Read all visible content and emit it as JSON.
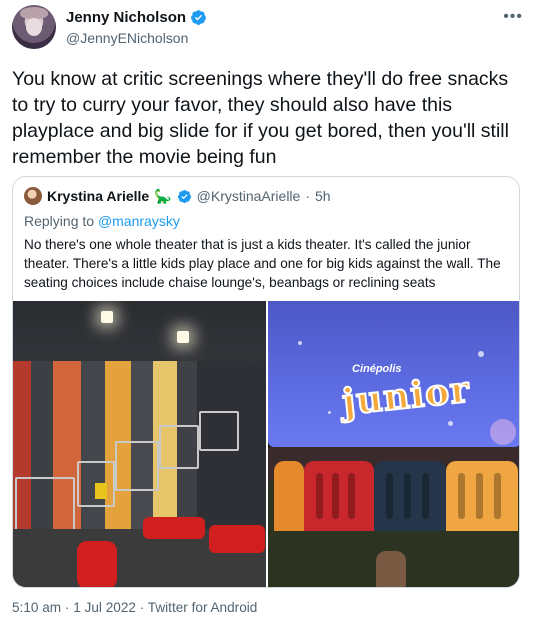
{
  "author": {
    "name": "Jenny Nicholson",
    "handle": "@JennyENicholson",
    "verified": true
  },
  "more_icon": "more-horizontal-icon",
  "tweet_text": "You know at critic screenings where they'll do free snacks to try to curry your favor, they should also have this playplace and big slide for if you get bored, then you'll still remember the movie being fun",
  "quote": {
    "name": "Krystina Arielle",
    "emoji": "🦕",
    "verified": true,
    "handle": "@KrystinaArielle",
    "separator": "·",
    "time": "5h",
    "replying_prefix": "Replying to",
    "replying_to": "@manraysky",
    "text": "No there's one whole theater that is just a kids theater. It's called the junior theater. There's a little kids play place and one for big kids against the wall. The seating choices include chaise lounge's, beanbags or reclining seats",
    "photos": {
      "right_photo_brand": "Cinépolis",
      "right_photo_logo": "junior"
    }
  },
  "footer": {
    "time": "5:10 am",
    "dot1": "·",
    "date": "1 Jul 2022",
    "dot2": "·",
    "source": "Twitter for Android"
  },
  "colors": {
    "verified_badge": "#1d9bf0",
    "secondary_text": "#536471",
    "border": "#cfd9de"
  }
}
